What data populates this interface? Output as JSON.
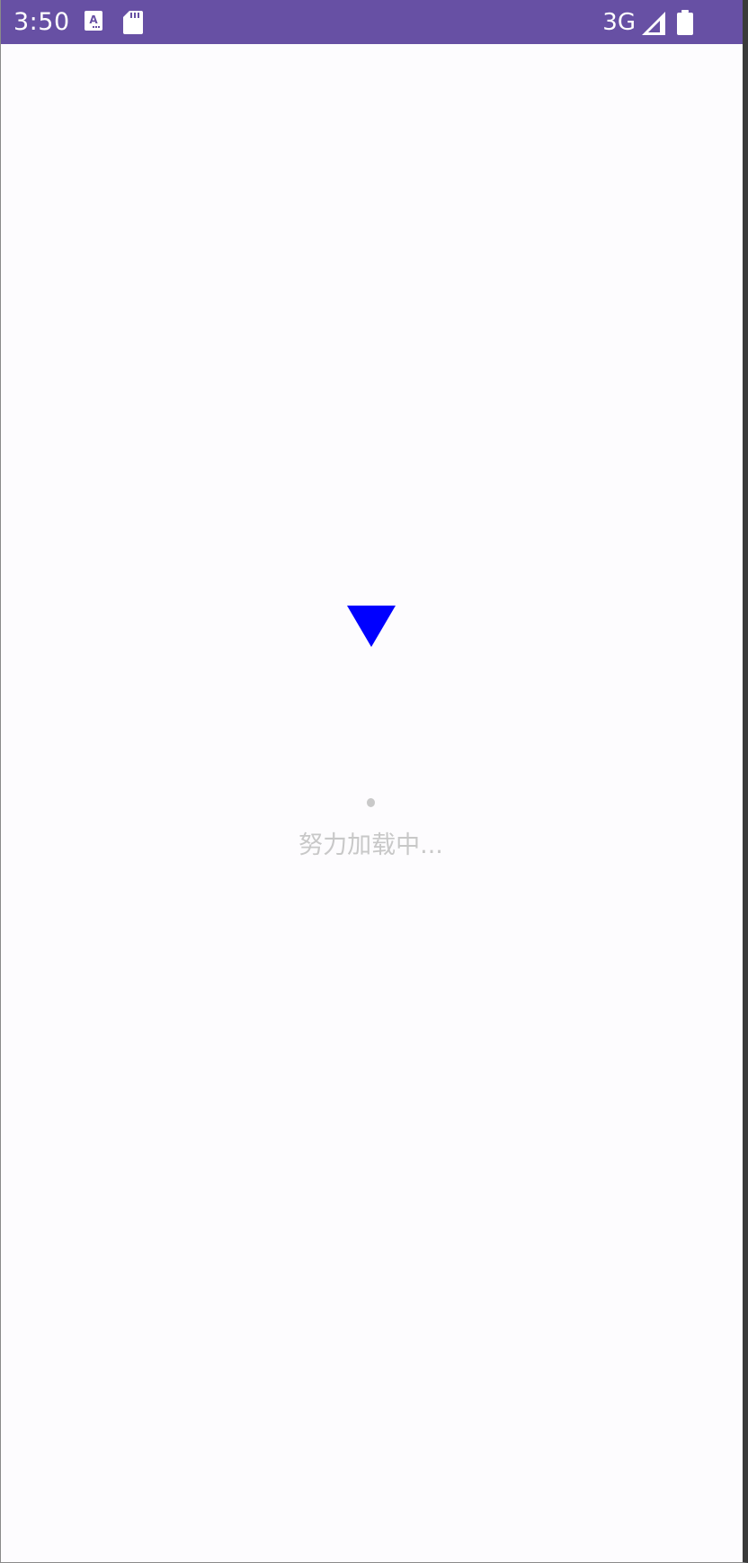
{
  "status_bar": {
    "time": "3:50",
    "network": "3G",
    "background_color": "#6750a4",
    "icons": [
      "font-a-icon",
      "sd-card-icon",
      "signal-icon",
      "battery-icon"
    ]
  },
  "loading": {
    "indicator_color": "#0000ff",
    "message": "努力加载中..."
  }
}
